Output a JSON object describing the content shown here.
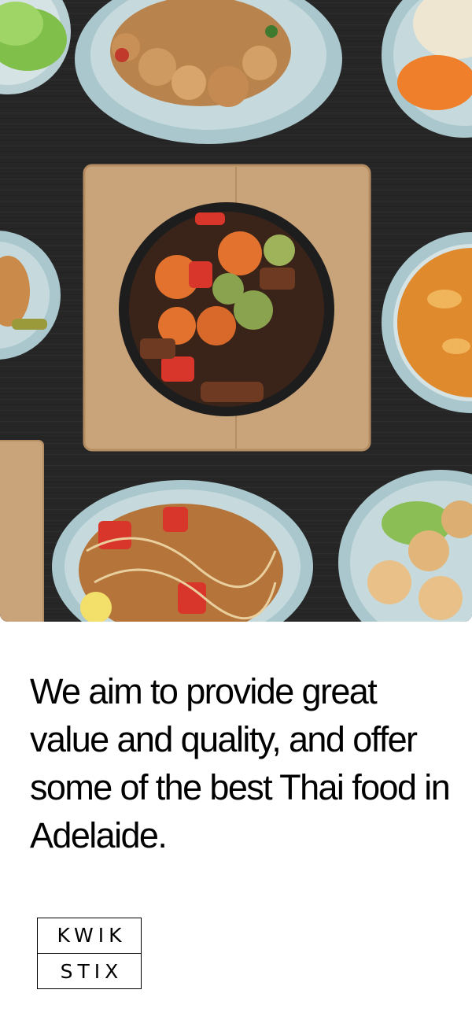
{
  "hero": {
    "description_icon": "thai-food-table-photo",
    "colors": {
      "table": "#262626",
      "board": "#c9a37a",
      "plate": "#b8cfd3",
      "curry": "#e08a2e"
    }
  },
  "tagline": "We aim to provide great value and quality, and offer some of the best Thai food in Adelaide.",
  "logo": {
    "line1": "KWIK",
    "line2": "STIX"
  }
}
